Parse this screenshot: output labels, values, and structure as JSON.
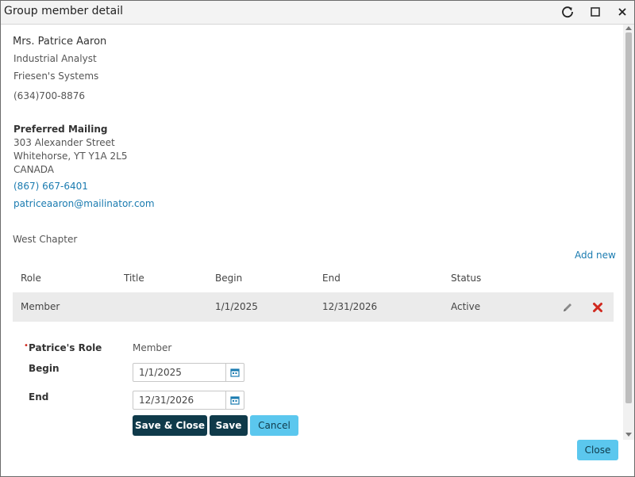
{
  "window": {
    "title": "Group member detail"
  },
  "member": {
    "name": "Mrs. Patrice Aaron",
    "job_title": "Industrial Analyst",
    "company": "Friesen's Systems",
    "phone": "(634)700-8876"
  },
  "address": {
    "heading": "Preferred Mailing",
    "street": "303 Alexander Street",
    "city_line": "Whitehorse, YT Y1A 2L5",
    "country": "CANADA",
    "phone": "(867) 667-6401",
    "email": "patriceaaron@mailinator.com"
  },
  "group": {
    "name": "West Chapter",
    "add_new_label": "Add new",
    "columns": [
      "Role",
      "Title",
      "Begin",
      "End",
      "Status"
    ],
    "rows": [
      {
        "role": "Member",
        "title": "",
        "begin": "1/1/2025",
        "end": "12/31/2026",
        "status": "Active"
      }
    ]
  },
  "form": {
    "role_label": "Patrice's Role",
    "required_marker": "•",
    "role_value": "Member",
    "begin_label": "Begin",
    "begin_value": "1/1/2025",
    "end_label": "End",
    "end_value": "12/31/2026",
    "save_close_label": "Save & Close",
    "save_label": "Save",
    "cancel_label": "Cancel"
  },
  "footer": {
    "close_label": "Close"
  },
  "colors": {
    "accent": "#5bc7ee",
    "dark_button": "#0f3a4a",
    "link": "#1a7bb0",
    "delete": "#d0281e"
  }
}
